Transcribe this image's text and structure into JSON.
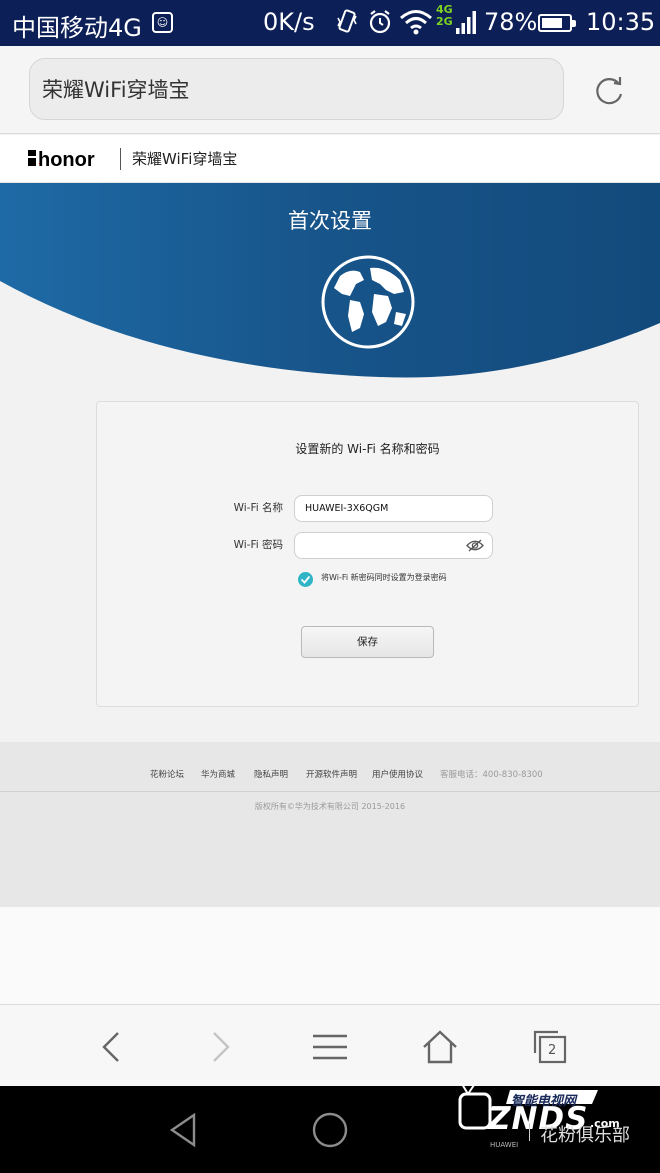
{
  "status_bar": {
    "carrier": "中国移动4G",
    "sim_icon": "sim-icon",
    "speed": "0K/s",
    "network_top": "4G",
    "network_bottom": "2G",
    "battery_percent": "78%",
    "battery_level": 0.78,
    "time": "10:35"
  },
  "browser": {
    "url_text": "荣耀WiFi穿墙宝",
    "reload_icon": "reload-icon",
    "tab_count": "2"
  },
  "site": {
    "brand_logo_text": "荣耀honor",
    "header_title": "荣耀WiFi穿墙宝",
    "banner_title": "首次设置"
  },
  "form": {
    "title": "设置新的 Wi-Fi 名称和密码",
    "name_label": "Wi-Fi 名称",
    "name_value": "HUAWEI-3X6QGM",
    "password_label": "Wi-Fi 密码",
    "password_value": "",
    "checkbox_checked": true,
    "checkbox_label": "将Wi-Fi 新密码同时设置为登录密码",
    "save_label": "保存"
  },
  "footer": {
    "links": [
      "花粉论坛",
      "华为商城",
      "隐私声明",
      "开源软件声明",
      "用户使用协议"
    ],
    "hotline": "客服电话：400-830-8300",
    "copyright": "版权所有©华为技术有限公司 2015-2016"
  },
  "watermark": {
    "cn_title": "智能电视网",
    "brand": "ZNDS",
    "suffix": ".com",
    "huawei": "HUAWEI",
    "club": "花粉俱乐部"
  },
  "colors": {
    "status_bar_bg": "#0d1f57",
    "banner_blue": "#1b5a94",
    "check_teal": "#2fb5c6"
  }
}
